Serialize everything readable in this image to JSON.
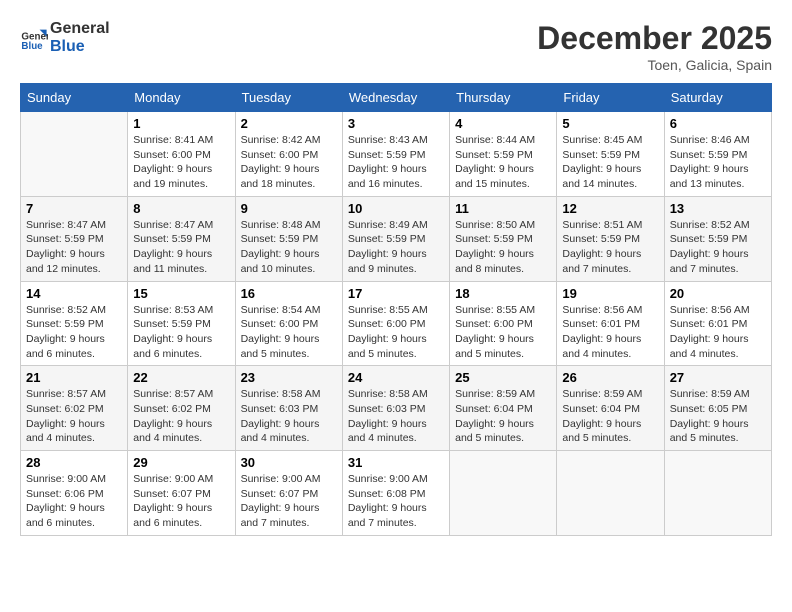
{
  "logo": {
    "line1": "General",
    "line2": "Blue"
  },
  "title": "December 2025",
  "location": "Toen, Galicia, Spain",
  "weekdays": [
    "Sunday",
    "Monday",
    "Tuesday",
    "Wednesday",
    "Thursday",
    "Friday",
    "Saturday"
  ],
  "weeks": [
    [
      {
        "num": "",
        "sunrise": "",
        "sunset": "",
        "daylight": ""
      },
      {
        "num": "1",
        "sunrise": "Sunrise: 8:41 AM",
        "sunset": "Sunset: 6:00 PM",
        "daylight": "Daylight: 9 hours and 19 minutes."
      },
      {
        "num": "2",
        "sunrise": "Sunrise: 8:42 AM",
        "sunset": "Sunset: 6:00 PM",
        "daylight": "Daylight: 9 hours and 18 minutes."
      },
      {
        "num": "3",
        "sunrise": "Sunrise: 8:43 AM",
        "sunset": "Sunset: 5:59 PM",
        "daylight": "Daylight: 9 hours and 16 minutes."
      },
      {
        "num": "4",
        "sunrise": "Sunrise: 8:44 AM",
        "sunset": "Sunset: 5:59 PM",
        "daylight": "Daylight: 9 hours and 15 minutes."
      },
      {
        "num": "5",
        "sunrise": "Sunrise: 8:45 AM",
        "sunset": "Sunset: 5:59 PM",
        "daylight": "Daylight: 9 hours and 14 minutes."
      },
      {
        "num": "6",
        "sunrise": "Sunrise: 8:46 AM",
        "sunset": "Sunset: 5:59 PM",
        "daylight": "Daylight: 9 hours and 13 minutes."
      }
    ],
    [
      {
        "num": "7",
        "sunrise": "Sunrise: 8:47 AM",
        "sunset": "Sunset: 5:59 PM",
        "daylight": "Daylight: 9 hours and 12 minutes."
      },
      {
        "num": "8",
        "sunrise": "Sunrise: 8:47 AM",
        "sunset": "Sunset: 5:59 PM",
        "daylight": "Daylight: 9 hours and 11 minutes."
      },
      {
        "num": "9",
        "sunrise": "Sunrise: 8:48 AM",
        "sunset": "Sunset: 5:59 PM",
        "daylight": "Daylight: 9 hours and 10 minutes."
      },
      {
        "num": "10",
        "sunrise": "Sunrise: 8:49 AM",
        "sunset": "Sunset: 5:59 PM",
        "daylight": "Daylight: 9 hours and 9 minutes."
      },
      {
        "num": "11",
        "sunrise": "Sunrise: 8:50 AM",
        "sunset": "Sunset: 5:59 PM",
        "daylight": "Daylight: 9 hours and 8 minutes."
      },
      {
        "num": "12",
        "sunrise": "Sunrise: 8:51 AM",
        "sunset": "Sunset: 5:59 PM",
        "daylight": "Daylight: 9 hours and 7 minutes."
      },
      {
        "num": "13",
        "sunrise": "Sunrise: 8:52 AM",
        "sunset": "Sunset: 5:59 PM",
        "daylight": "Daylight: 9 hours and 7 minutes."
      }
    ],
    [
      {
        "num": "14",
        "sunrise": "Sunrise: 8:52 AM",
        "sunset": "Sunset: 5:59 PM",
        "daylight": "Daylight: 9 hours and 6 minutes."
      },
      {
        "num": "15",
        "sunrise": "Sunrise: 8:53 AM",
        "sunset": "Sunset: 5:59 PM",
        "daylight": "Daylight: 9 hours and 6 minutes."
      },
      {
        "num": "16",
        "sunrise": "Sunrise: 8:54 AM",
        "sunset": "Sunset: 6:00 PM",
        "daylight": "Daylight: 9 hours and 5 minutes."
      },
      {
        "num": "17",
        "sunrise": "Sunrise: 8:55 AM",
        "sunset": "Sunset: 6:00 PM",
        "daylight": "Daylight: 9 hours and 5 minutes."
      },
      {
        "num": "18",
        "sunrise": "Sunrise: 8:55 AM",
        "sunset": "Sunset: 6:00 PM",
        "daylight": "Daylight: 9 hours and 5 minutes."
      },
      {
        "num": "19",
        "sunrise": "Sunrise: 8:56 AM",
        "sunset": "Sunset: 6:01 PM",
        "daylight": "Daylight: 9 hours and 4 minutes."
      },
      {
        "num": "20",
        "sunrise": "Sunrise: 8:56 AM",
        "sunset": "Sunset: 6:01 PM",
        "daylight": "Daylight: 9 hours and 4 minutes."
      }
    ],
    [
      {
        "num": "21",
        "sunrise": "Sunrise: 8:57 AM",
        "sunset": "Sunset: 6:02 PM",
        "daylight": "Daylight: 9 hours and 4 minutes."
      },
      {
        "num": "22",
        "sunrise": "Sunrise: 8:57 AM",
        "sunset": "Sunset: 6:02 PM",
        "daylight": "Daylight: 9 hours and 4 minutes."
      },
      {
        "num": "23",
        "sunrise": "Sunrise: 8:58 AM",
        "sunset": "Sunset: 6:03 PM",
        "daylight": "Daylight: 9 hours and 4 minutes."
      },
      {
        "num": "24",
        "sunrise": "Sunrise: 8:58 AM",
        "sunset": "Sunset: 6:03 PM",
        "daylight": "Daylight: 9 hours and 4 minutes."
      },
      {
        "num": "25",
        "sunrise": "Sunrise: 8:59 AM",
        "sunset": "Sunset: 6:04 PM",
        "daylight": "Daylight: 9 hours and 5 minutes."
      },
      {
        "num": "26",
        "sunrise": "Sunrise: 8:59 AM",
        "sunset": "Sunset: 6:04 PM",
        "daylight": "Daylight: 9 hours and 5 minutes."
      },
      {
        "num": "27",
        "sunrise": "Sunrise: 8:59 AM",
        "sunset": "Sunset: 6:05 PM",
        "daylight": "Daylight: 9 hours and 5 minutes."
      }
    ],
    [
      {
        "num": "28",
        "sunrise": "Sunrise: 9:00 AM",
        "sunset": "Sunset: 6:06 PM",
        "daylight": "Daylight: 9 hours and 6 minutes."
      },
      {
        "num": "29",
        "sunrise": "Sunrise: 9:00 AM",
        "sunset": "Sunset: 6:07 PM",
        "daylight": "Daylight: 9 hours and 6 minutes."
      },
      {
        "num": "30",
        "sunrise": "Sunrise: 9:00 AM",
        "sunset": "Sunset: 6:07 PM",
        "daylight": "Daylight: 9 hours and 7 minutes."
      },
      {
        "num": "31",
        "sunrise": "Sunrise: 9:00 AM",
        "sunset": "Sunset: 6:08 PM",
        "daylight": "Daylight: 9 hours and 7 minutes."
      },
      {
        "num": "",
        "sunrise": "",
        "sunset": "",
        "daylight": ""
      },
      {
        "num": "",
        "sunrise": "",
        "sunset": "",
        "daylight": ""
      },
      {
        "num": "",
        "sunrise": "",
        "sunset": "",
        "daylight": ""
      }
    ]
  ]
}
